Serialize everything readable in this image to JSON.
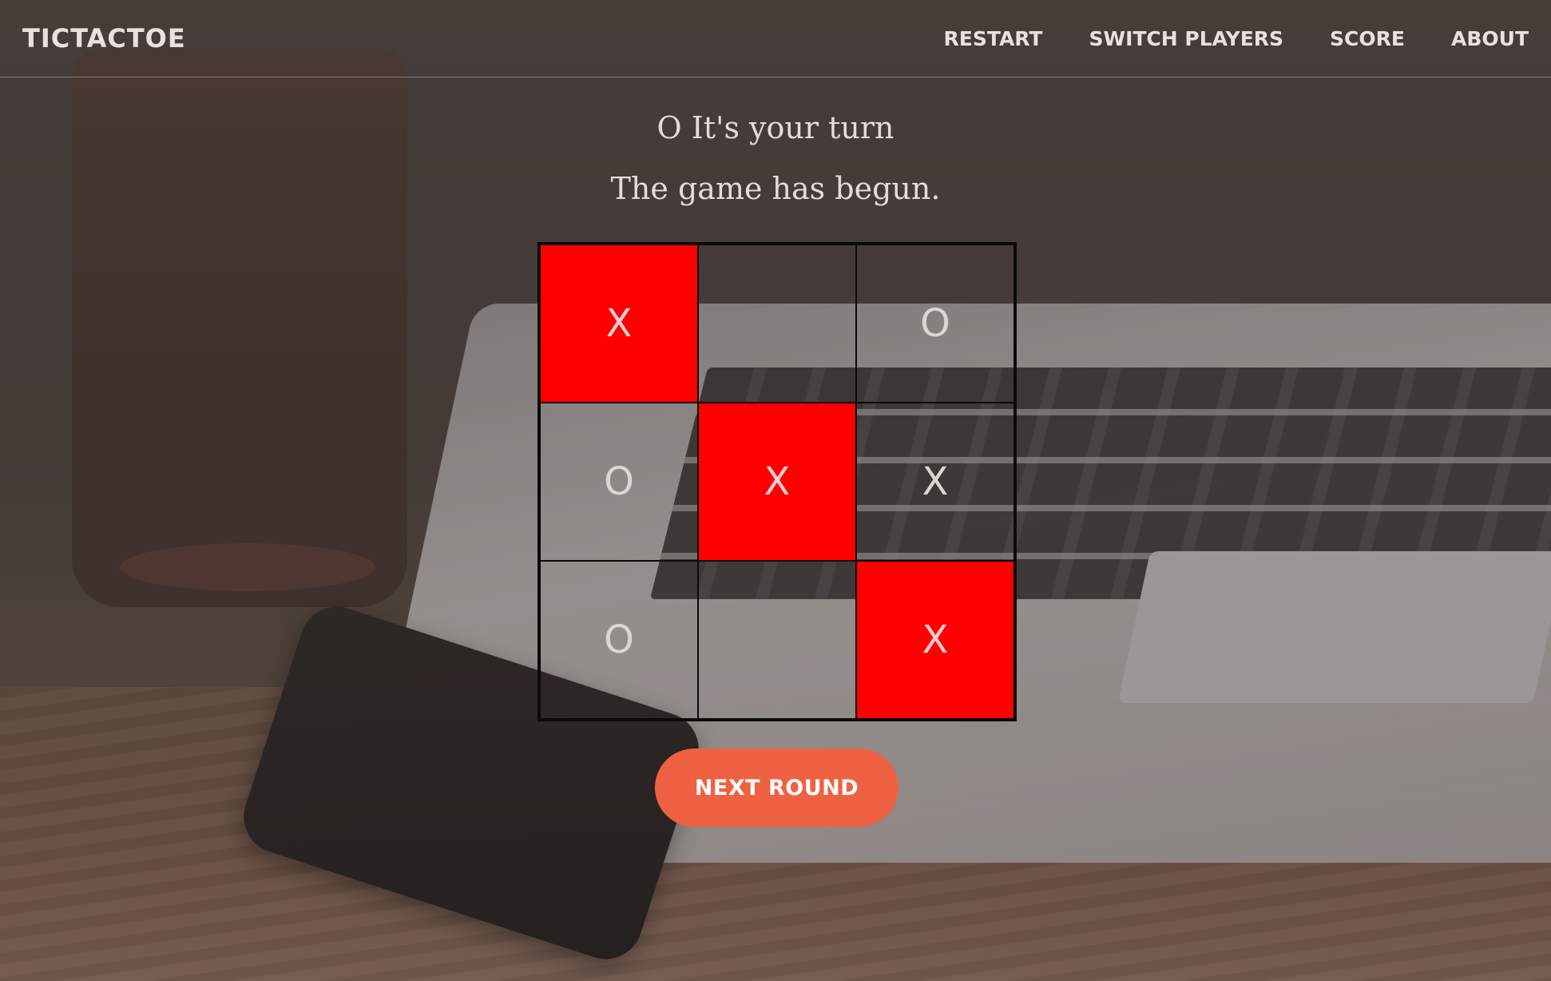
{
  "navbar": {
    "brand": "TICTACTOE",
    "links": [
      {
        "label": "RESTART"
      },
      {
        "label": "SWITCH PLAYERS"
      },
      {
        "label": "SCORE"
      },
      {
        "label": "ABOUT"
      }
    ]
  },
  "status": {
    "turn": "O It's your turn",
    "message": "The game has begun."
  },
  "board": {
    "cells": [
      {
        "mark": "X",
        "winning": true
      },
      {
        "mark": "",
        "winning": false
      },
      {
        "mark": "O",
        "winning": false
      },
      {
        "mark": "O",
        "winning": false
      },
      {
        "mark": "X",
        "winning": true
      },
      {
        "mark": "X",
        "winning": false
      },
      {
        "mark": "O",
        "winning": false
      },
      {
        "mark": "",
        "winning": false
      },
      {
        "mark": "X",
        "winning": true
      }
    ],
    "highlight_color": "#ff0000"
  },
  "actions": {
    "next_round_label": "NEXT ROUND",
    "button_color": "#ef6143"
  }
}
